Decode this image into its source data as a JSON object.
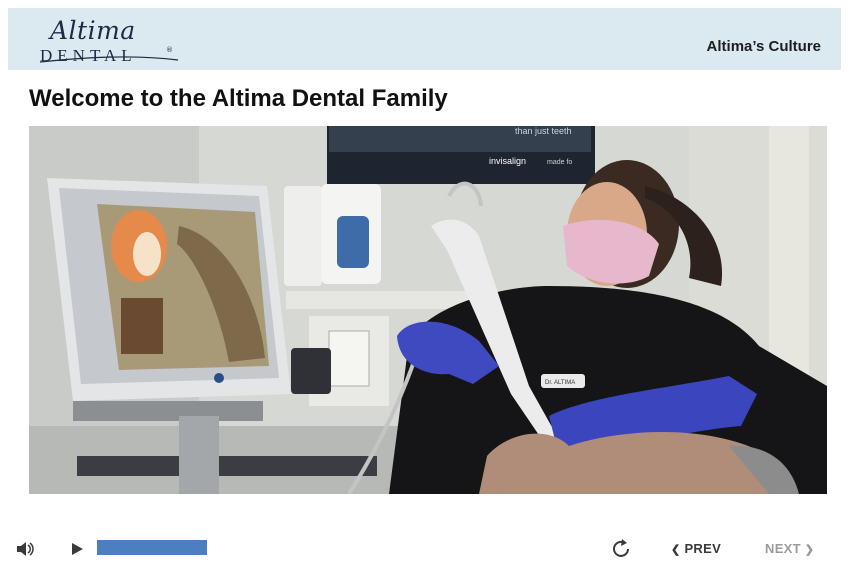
{
  "header": {
    "logo_top": "Altima",
    "logo_bottom": "DENTAL",
    "logo_mark": "®",
    "section_title": "Altima’s Culture"
  },
  "page": {
    "title": "Welcome to the Altima Dental Family"
  },
  "video": {
    "poster_text_1": "than just teeth",
    "poster_text_2": "invisalign",
    "poster_text_3": "made fo",
    "badge_text": "Dr. ALTIMA"
  },
  "player": {
    "volume_icon": "speaker-icon",
    "play_icon": "play-icon",
    "progress": 1.0,
    "replay_icon": "replay-icon",
    "prev_label": "PREV",
    "next_label": "NEXT",
    "accent_color": "#4a7fc1",
    "next_disabled": true
  }
}
